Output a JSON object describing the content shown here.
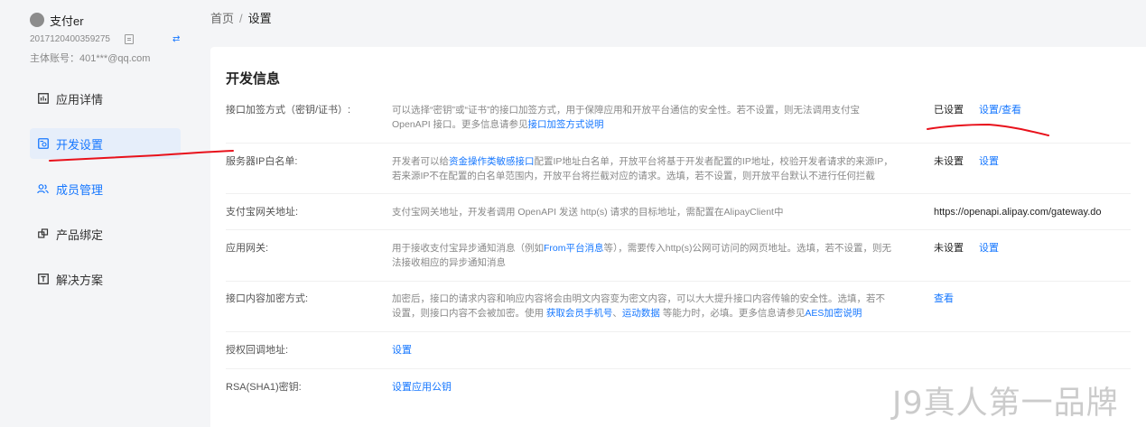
{
  "app": {
    "name": "支付er",
    "app_id": "2017120400359275",
    "account": "主体账号：401***@qq.com"
  },
  "sidebar": {
    "items": [
      {
        "label": "应用详情",
        "icon": "chart-icon",
        "active": false
      },
      {
        "label": "开发设置",
        "icon": "settings-doc-icon",
        "active": true
      },
      {
        "label": "成员管理",
        "icon": "members-icon",
        "active": false
      },
      {
        "label": "产品绑定",
        "icon": "link-icon",
        "active": false
      },
      {
        "label": "解决方案",
        "icon": "solution-icon",
        "active": false
      }
    ]
  },
  "breadcrumb": {
    "home": "首页",
    "separator": "/",
    "current": "设置"
  },
  "main": {
    "title": "开发信息",
    "rows": {
      "sign": {
        "label": "接口加签方式（密钥/证书）:",
        "desc_1": "可以选择“密钥”或“证书”的接口加签方式，用于保障应用和开放平台通信的安全性。若不设置，则无法调用支付宝 OpenAPI 接口。更多信息请参见",
        "desc_link": "接口加签方式说明",
        "status": "已设置",
        "action": "设置/查看"
      },
      "ip": {
        "label": "服务器IP白名单:",
        "desc_1": "开发者可以给",
        "desc_link": "资金操作类敏感接口",
        "desc_2": "配置IP地址白名单，开放平台将基于开发者配置的IP地址，校验开发者请求的来源IP，若来源IP不在配置的白名单范围内，开放平台将拦截对应的请求。选填，若不设置，则开放平台默认不进行任何拦截",
        "status": "未设置",
        "action": "设置"
      },
      "gateway": {
        "label": "支付宝网关地址:",
        "desc": "支付宝网关地址，开发者调用 OpenAPI 发送 http(s) 请求的目标地址，需配置在AlipayClient中",
        "value": "https://openapi.alipay.com/gateway.do"
      },
      "app_gateway": {
        "label": "应用网关:",
        "desc_1": "用于接收支付宝异步通知消息（例如",
        "desc_link": "From平台消息",
        "desc_2": "等），需要传入http(s)公网可访问的网页地址。选填，若不设置，则无法接收相应的异步通知消息",
        "status": "未设置",
        "action": "设置"
      },
      "encrypt": {
        "label": "接口内容加密方式:",
        "desc_1": "加密后，接口的请求内容和响应内容将会由明文内容变为密文内容，可以大大提升接口内容传输的安全性。选填，若不设置，则接口内容不会被加密。使用 ",
        "desc_link_1": "获取会员手机号",
        "desc_mid": "、",
        "desc_link_2": "运动数据",
        "desc_2": " 等能力时，必填。更多信息请参见",
        "desc_link_3": "AES加密说明",
        "action": "查看"
      },
      "auth_callback": {
        "label": "授权回调地址:",
        "action": "设置"
      },
      "rsa": {
        "label": "RSA(SHA1)密钥:",
        "action": "设置应用公钥"
      }
    }
  },
  "watermark": "J9真人第一品牌",
  "colors": {
    "accent": "#1677ff",
    "annotation": "#e8111b"
  }
}
